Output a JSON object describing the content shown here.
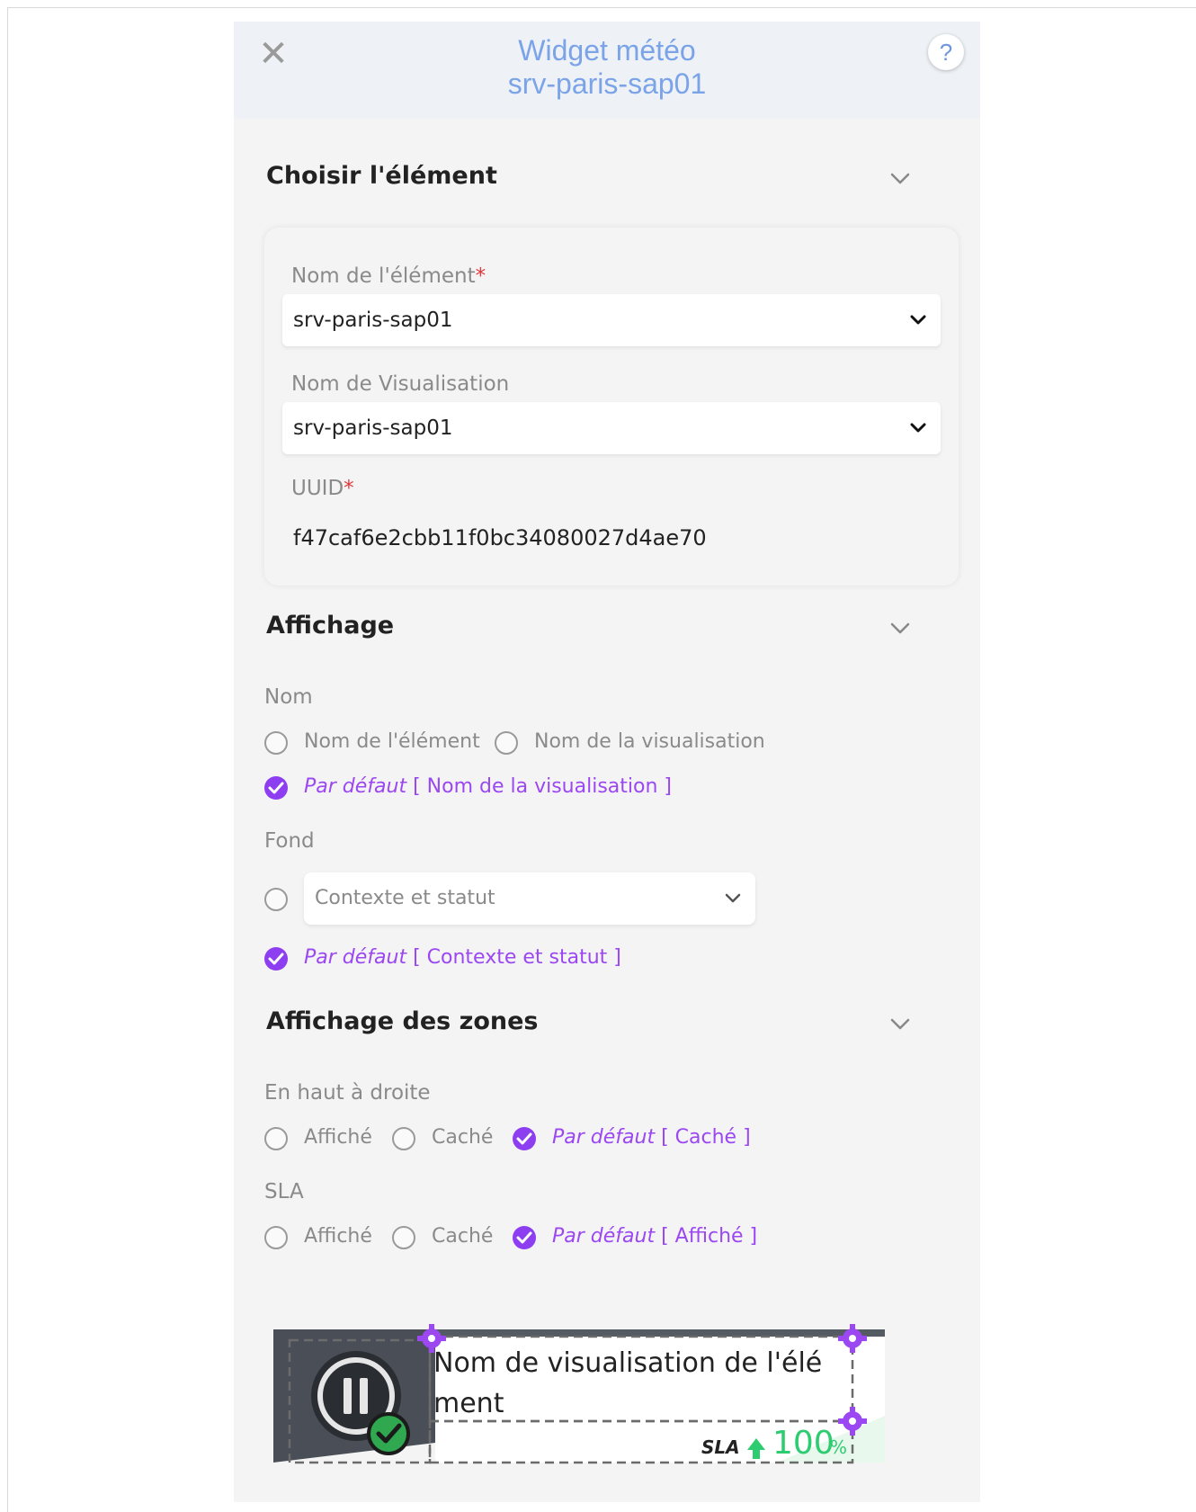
{
  "header": {
    "title_line1": "Widget météo",
    "title_line2": "srv-paris-sap01",
    "close_icon": "✕",
    "help_label": "?"
  },
  "section_element": {
    "title": "Choisir l'élément",
    "nom_element_label": "Nom de l'élément",
    "nom_element_value": "srv-paris-sap01",
    "nom_visualisation_label": "Nom de Visualisation",
    "nom_visualisation_value": "srv-paris-sap01",
    "uuid_label": "UUID",
    "uuid_value": "f47caf6e2cbb11f0bc34080027d4ae70",
    "required_mark": "*"
  },
  "section_affichage": {
    "title": "Affichage",
    "nom_label": "Nom",
    "opt_element": "Nom de l'élément",
    "opt_visualisation": "Nom de la visualisation",
    "default_prefix": "Par défaut",
    "default_nom_value": "[ Nom de la visualisation ]",
    "fond_label": "Fond",
    "fond_select_value": "Contexte et statut",
    "default_fond_value": "[ Contexte et statut ]"
  },
  "section_zones": {
    "title": "Affichage des zones",
    "haut_droite_label": "En haut à droite",
    "opt_affiche": "Affiché",
    "opt_cache": "Caché",
    "default_prefix": "Par défaut",
    "default_haut_droite_value": "[ Caché ]",
    "sla_label": "SLA",
    "default_sla_value": "[ Affiché ]"
  },
  "preview": {
    "name_text_line1": "Nom de visualisation de l'élé",
    "name_text_line2": "ment",
    "sla_label": "SLA",
    "sla_value": "100",
    "sla_unit": "%",
    "accent_purple": "#9b47f2",
    "accent_green": "#2ecc71"
  }
}
